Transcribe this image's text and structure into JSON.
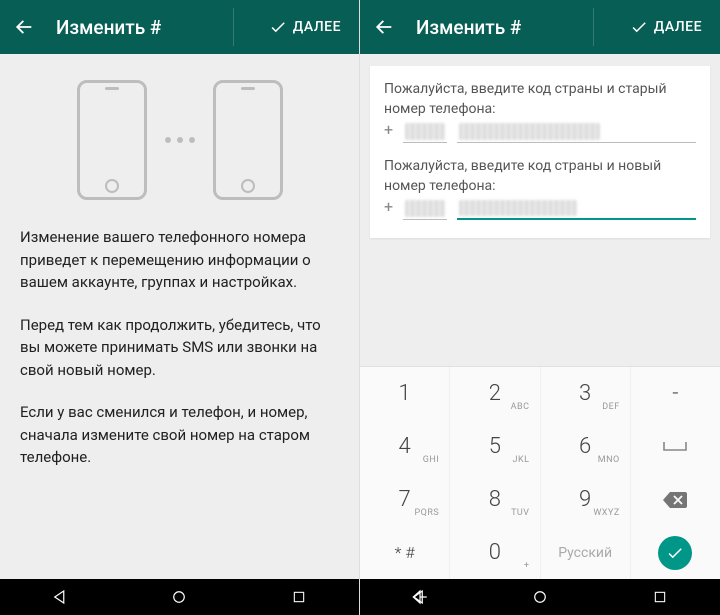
{
  "appbar": {
    "title": "Изменить #",
    "next": "ДАЛЕЕ"
  },
  "left": {
    "paragraph1": "Изменение вашего телефонного номера приведет к перемещению информации о вашем аккаунте, группах и настройках.",
    "paragraph2": "Перед тем как продолжить, убедитесь, что вы можете принимать SMS или звонки на свой новый номер.",
    "paragraph3": "Если у вас сменился и телефон, и номер, сначала измените свой номер на старом телефоне."
  },
  "right": {
    "label_old": "Пожалуйста, введите код страны и старый номер телефона:",
    "label_new": "Пожалуйста, введите код страны и новый номер телефона:",
    "plus": "+",
    "language_hint": "Русский"
  },
  "keypad": {
    "k1": "1",
    "k2": "2",
    "k2l": "ABC",
    "k3": "3",
    "k3l": "DEF",
    "k4": "4",
    "k4l": "GHI",
    "k5": "5",
    "k5l": "JKL",
    "k6": "6",
    "k6l": "MNO",
    "k7": "7",
    "k7l": "PQRS",
    "k8": "8",
    "k8l": "TUV",
    "k9": "9",
    "k9l": "WXYZ",
    "kstar": "*   #",
    "k0": "0",
    "k0l": "+",
    "dash": "-"
  }
}
